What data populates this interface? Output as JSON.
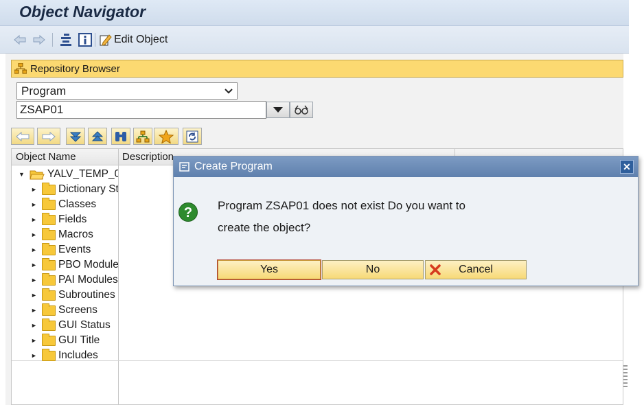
{
  "window": {
    "title": "Object Navigator"
  },
  "toolbar": {
    "back_icon": "back-arrow-icon",
    "forward_icon": "forward-arrow-icon",
    "edit_label": "Edit Object"
  },
  "repository": {
    "label": "Repository Browser"
  },
  "object_type": {
    "selected": "Program"
  },
  "object_name": {
    "value": "ZSAP01"
  },
  "tree": {
    "headers": {
      "name": "Object Name",
      "description": "Description"
    },
    "root": "YALV_TEMP_0",
    "items": [
      "Dictionary St",
      "Classes",
      "Fields",
      "Macros",
      "Events",
      "PBO Modules",
      "PAI Modules",
      "Subroutines",
      "Screens",
      "GUI Status",
      "GUI Title",
      "Includes"
    ]
  },
  "dialog": {
    "title": "Create Program",
    "message_line1": "Program ZSAP01 does not exist Do you want to",
    "message_line2": "create the object?",
    "yes": "Yes",
    "no": "No",
    "cancel": "Cancel"
  },
  "colors": {
    "repo_bar": "#fcd971",
    "dialog_title": "#5f80ad",
    "button": "#f7d977"
  }
}
